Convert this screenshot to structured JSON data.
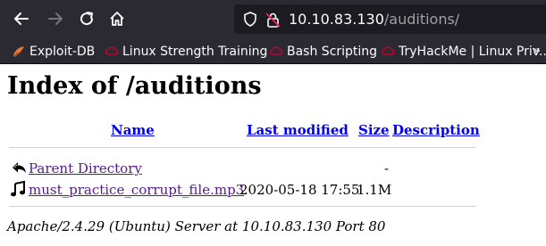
{
  "browser": {
    "url_host": "10.10.83.130",
    "url_path": "/auditions/"
  },
  "bookmarks": [
    {
      "label": "Exploit-DB",
      "icon": "exploit-db-icon"
    },
    {
      "label": "Linux Strength Training",
      "icon": "tryhackme-icon"
    },
    {
      "label": "Bash Scripting",
      "icon": "tryhackme-icon"
    },
    {
      "label": "TryHackMe | Linux Priv...",
      "icon": "tryhackme-icon"
    }
  ],
  "page": {
    "title": "Index of /auditions",
    "columns": {
      "name": "Name",
      "last_modified": "Last modified",
      "size": "Size",
      "description": "Description"
    },
    "rows": [
      {
        "name": "Parent Directory",
        "icon": "back-arrow-icon",
        "last_modified": "",
        "size": "-",
        "description": ""
      },
      {
        "name": "must_practice_corrupt_file.mp3",
        "icon": "sound-icon",
        "last_modified": "2020-05-18 17:55",
        "size": "1.1M",
        "description": ""
      }
    ],
    "footer": "Apache/2.4.29 (Ubuntu) Server at 10.10.83.130 Port 80"
  }
}
